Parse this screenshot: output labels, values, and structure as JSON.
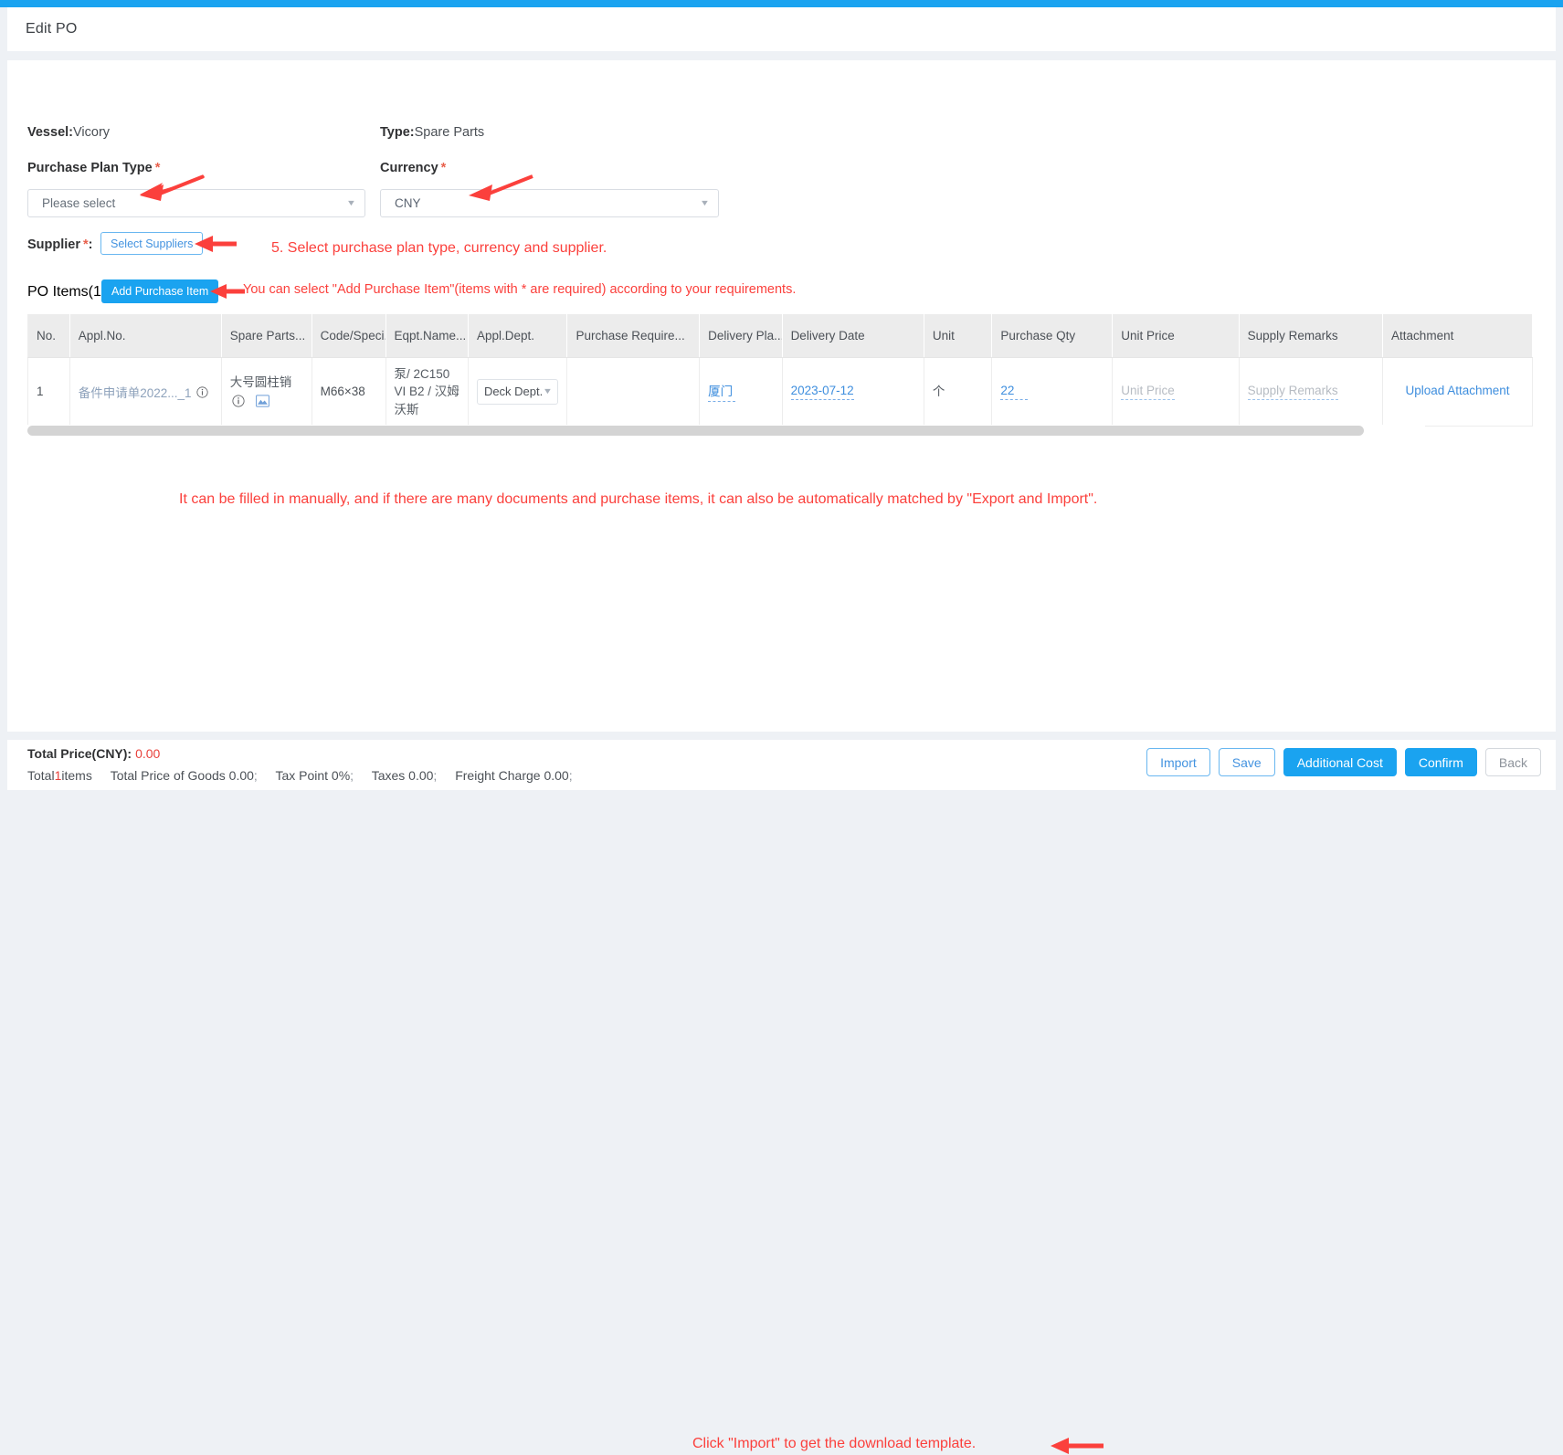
{
  "window": {
    "title": "Edit PO"
  },
  "accent_color": "#1aa3f0",
  "annotation_color": "#fb403c",
  "form": {
    "vessel_label": "Vessel:",
    "vessel_value": "Vicory",
    "type_label": "Type:",
    "type_value": "Spare Parts",
    "purchase_plan_type_label": "Purchase Plan Type",
    "purchase_plan_type_value": "Please select",
    "currency_label": "Currency",
    "currency_value": "CNY",
    "required_star": "*",
    "supplier_label": "Supplier",
    "supplier_colon": ":",
    "select_suppliers_button": "Select Suppliers",
    "po_items_label": "PO Items(1)",
    "add_purchase_item_button": "Add Purchase Item"
  },
  "annotations": {
    "step5": "5. Select purchase plan type, currency and supplier.",
    "add_item": "You can select \"Add Purchase Item\"(items with * are required) according to your requirements.",
    "fill_manually": "It can be filled in manually, and if there are many documents and purchase items, it can also be automatically matched by \"Export and Import\".",
    "import_hint": "Click \"Import\" to get the download template."
  },
  "table": {
    "columns": [
      "No.",
      "Appl.No.",
      "Spare Parts...",
      "Code/Speci...",
      "Eqpt.Name...",
      "Appl.Dept.",
      "Purchase Require...",
      "Delivery Pla...",
      "Delivery Date",
      "Unit",
      "Purchase Qty",
      "Unit Price",
      "Supply Remarks",
      "Attachment"
    ],
    "rows": [
      {
        "no": "1",
        "appl_no": "备件申请单2022..._1",
        "appl_no_info_icon": "info-circle-icon",
        "spare_parts_name": "大号圆柱销",
        "spare_parts_info_icon": "info-circle-icon",
        "spare_parts_image_icon": "image-icon",
        "code_spec": "M66×38",
        "eqpt_name": "泵/ 2C150 VI B2 / 汉姆沃斯",
        "appl_dept": "Deck Dept.",
        "purchase_require": "",
        "delivery_place": "厦门",
        "delivery_date": "2023-07-12",
        "unit": "个",
        "purchase_qty": "22",
        "unit_price_placeholder": "Unit Price",
        "supply_remarks_placeholder": "Supply Remarks",
        "attachment_link": "Upload Attachment"
      }
    ]
  },
  "footer": {
    "total_price_label": "Total Price(CNY):",
    "total_price_value": "0.00",
    "total_prefix": "Total",
    "total_count": "1",
    "total_suffix": "items",
    "total_price_of_goods": "Total Price of Goods 0.00",
    "tax_point": "Tax Point 0%",
    "taxes": "Taxes 0.00",
    "freight_charge": "Freight Charge 0.00",
    "semicolon": ";",
    "buttons": {
      "import": "Import",
      "save": "Save",
      "additional_cost": "Additional Cost",
      "confirm": "Confirm",
      "back": "Back"
    }
  }
}
